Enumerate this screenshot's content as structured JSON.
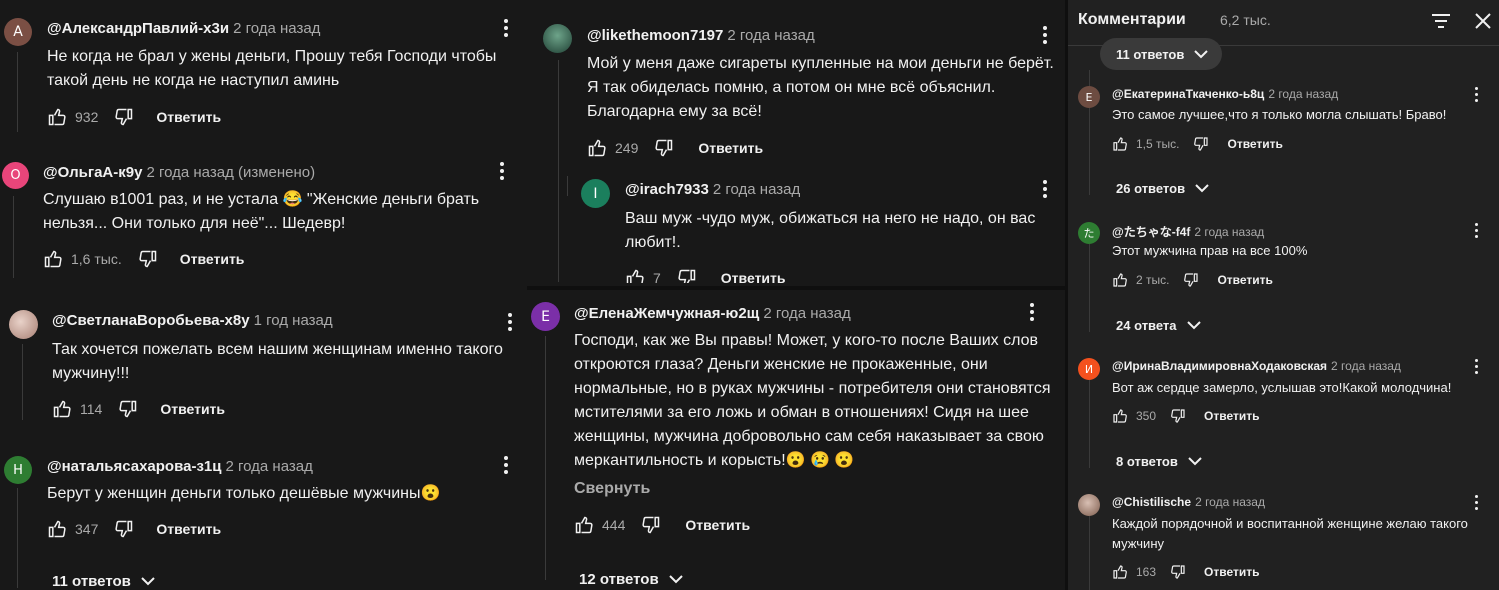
{
  "col1": {
    "comments": [
      {
        "avatar_letter": "А",
        "avatar_color": "#7b4f44",
        "author": "@АлександрПавлий-х3и",
        "time": "2 года назад",
        "text": "Не когда не брал у жены деньги, Прошу тебя Господи чтобы такой день не когда не наступил аминь",
        "likes": "932",
        "reply": "Ответить"
      },
      {
        "avatar_letter": "О",
        "avatar_color": "#e8457a",
        "author": "@ОльгаА-к9у",
        "time": "2 года назад (изменено)",
        "text": "Слушаю в1001 раз, и не устала 😂  \"Женские деньги брать нельзя... Они только для неё\"... Шедевр!",
        "likes": "1,6 тыс.",
        "reply": "Ответить"
      },
      {
        "avatar_letter": "",
        "avatar_color": "#c9a9a0",
        "author": "@СветланаВоробьева-х8у",
        "time": "1 год назад",
        "text": "Так хочется пожелать всем нашим женщинам именно такого мужчину!!!",
        "likes": "114",
        "reply": "Ответить"
      },
      {
        "avatar_letter": "Н",
        "avatar_color": "#2e7d32",
        "author": "@натальясахарова-з1ц",
        "time": "2 года назад",
        "text": "Берут у женщин деньги только дешёвые мужчины😮",
        "likes": "347",
        "reply": "Ответить"
      }
    ],
    "replies_label": "11 ответов"
  },
  "col2": {
    "comments": [
      {
        "avatar_letter": "",
        "avatar_color": "#2f5e4b",
        "author": "@likethemoon7197",
        "time": "2 года назад",
        "text": "Мой у меня даже сигареты купленные на мои деньги не берёт.  Я так обиделась помню, а потом он мне всё объяснил. Благодарна ему за всё!",
        "likes": "249",
        "reply": "Ответить"
      },
      {
        "avatar_letter": "I",
        "avatar_color": "#1b7f5d",
        "author": "@irach7933",
        "time": "2 года назад",
        "text": "Ваш муж -чудо муж, обижаться на него не надо, он вас любит!.",
        "likes": "7",
        "reply": "Ответить"
      },
      {
        "avatar_letter": "E",
        "avatar_color": "#7b2fa8",
        "author": "@ЕленаЖемчужная-ю2щ",
        "time": "2 года назад",
        "text": "Господи, как же Вы правы! Может, у кого-то после Ваших слов откроются глаза? Деньги женские не прокаженные, они  нормальные, но в руках мужчины -  потребителя они становятся мстителями за его ложь и обман в отношениях! Сидя на  шее женщины, мужчина   добровольно сам себя наказывает за свою меркантильность и  корысть!😮 😢 😮",
        "likes": "444",
        "reply": "Ответить"
      }
    ],
    "collapse": "Свернуть",
    "replies_label": "12 ответов"
  },
  "col3": {
    "title": "Комментарии",
    "count": "6,2 тыс.",
    "top_replies": "11 ответов",
    "comments": [
      {
        "avatar_letter": "Е",
        "avatar_color": "#6d4c41",
        "author": "@ЕкатеринаТкаченко-ь8ц",
        "time": "2 года назад",
        "text": "Это самое лучшее,что я только могла слышать! Браво!",
        "likes": "1,5 тыс.",
        "reply": "Ответить",
        "replies": "26 ответов"
      },
      {
        "avatar_letter": "た",
        "avatar_color": "#2e7d32",
        "author": "@たちゃな-f4f",
        "time": "2 года назад",
        "text": "Этот мужчина прав на все 100%",
        "likes": "2 тыс.",
        "reply": "Ответить",
        "replies": "24 ответа"
      },
      {
        "avatar_letter": "И",
        "avatar_color": "#f4511e",
        "author": "@ИринаВладимировнаХодаковская",
        "time": "2 года назад",
        "text": "Вот аж сердце замерло, услышав это!Какой молодчина!",
        "likes": "350",
        "reply": "Ответить",
        "replies": "8 ответов"
      },
      {
        "avatar_letter": "",
        "avatar_color": "#b08d7a",
        "author": "@Chistilische",
        "time": "2 года назад",
        "text": "Каждой порядочной и воспитанной женщине желаю такого мужчину",
        "likes": "163",
        "reply": "Ответить"
      }
    ]
  }
}
